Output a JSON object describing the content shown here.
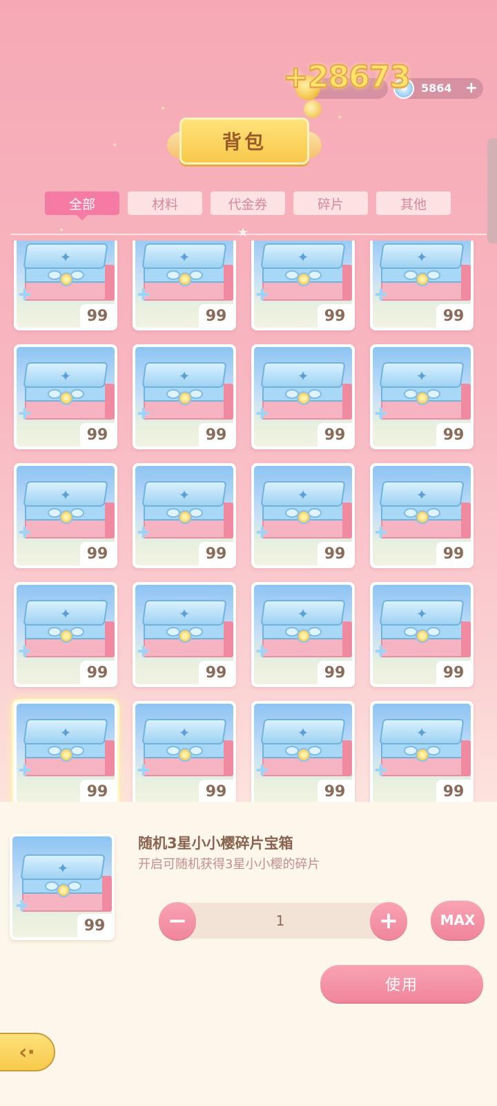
{
  "currency": {
    "gain": "+28673",
    "gems": "5864"
  },
  "title": "背包",
  "tabs": [
    {
      "label": "全部",
      "active": true
    },
    {
      "label": "材料",
      "active": false
    },
    {
      "label": "代金券",
      "active": false
    },
    {
      "label": "碎片",
      "active": false
    },
    {
      "label": "其他",
      "active": false
    }
  ],
  "grid": {
    "item_quantity": "99",
    "rows": 5,
    "columns": 4
  },
  "detail": {
    "name": "随机3星小小樱碎片宝箱",
    "description": "开启可随机获得3星小小樱的碎片",
    "owned": "99",
    "quantity": "1",
    "max_label": "MAX",
    "use_label": "使用"
  },
  "icons": {
    "gem": "gem-icon",
    "coin": "coin-icon",
    "back": "back-icon"
  },
  "colors": {
    "accent_pink": "#f57ba4",
    "button_pink": "#f0859c",
    "gold": "#f8c94c"
  }
}
